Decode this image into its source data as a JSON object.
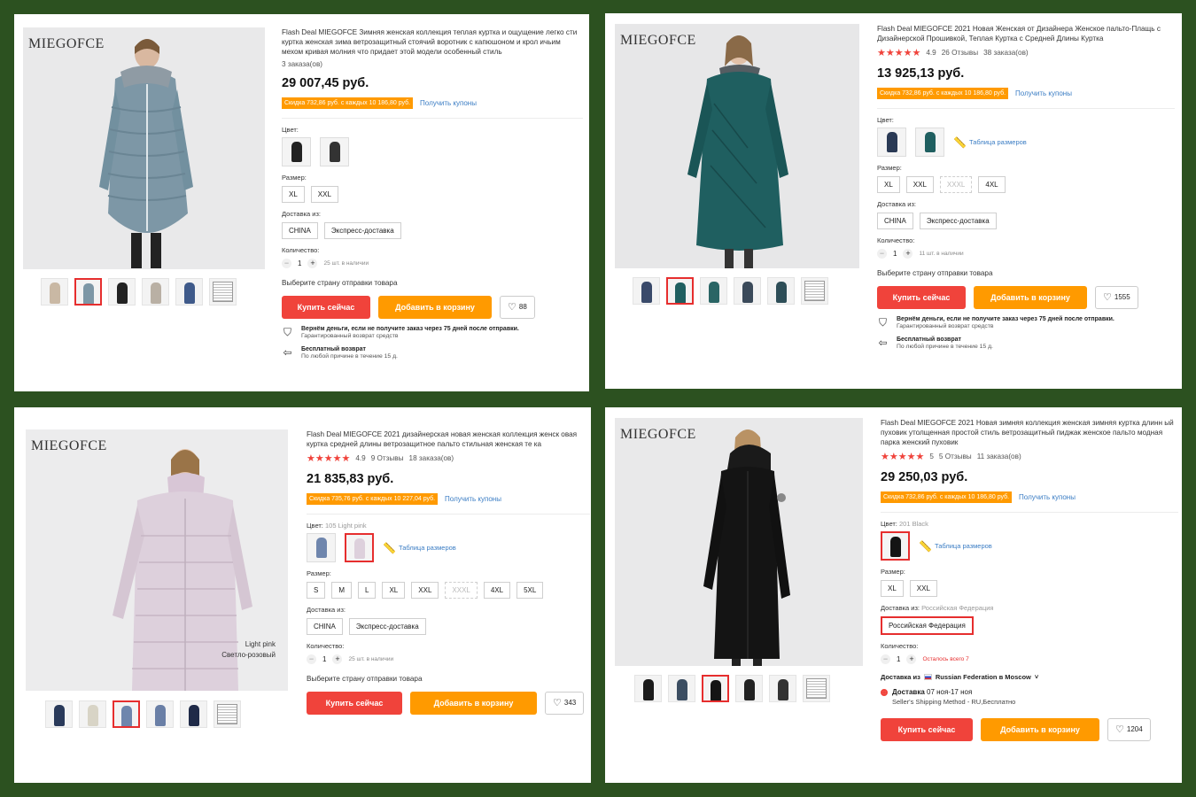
{
  "brand": "MIEGOFCE",
  "products": [
    {
      "title": "Flash Deal MIEGOFCE Зимняя женская коллекция теплая куртка и ощущение легко сти куртка женская зима ветрозащитный стоячий воротник с капюшоном и крол ичьим мехом кривая молния что придает этой модели особенный стиль",
      "orders": "3 заказа(ов)",
      "price": "29 007,45 руб.",
      "discount": "Скидка 732,86 руб. с каждых 10 186,80 руб.",
      "coupon_link": "Получить купоны",
      "color_label": "Цвет:",
      "size_label": "Размер:",
      "sizes": [
        "XL",
        "XXL"
      ],
      "ship_from_label": "Доставка из:",
      "ship_from": [
        "CHINA",
        "Экспресс-доставка"
      ],
      "qty_label": "Количество:",
      "qty_minus": "−",
      "qty_value": "1",
      "qty_plus": "+",
      "qty_avail": "25 шт. в наличии",
      "ship_note": "Выберите страну отправки товара",
      "buy": "Купить сейчас",
      "cart": "Добавить в корзину",
      "wish_count": "88",
      "guarantee_title": "Вернём деньги, если не получите заказ через 75 дней после отправки.",
      "guarantee_sub": "Гарантированный возврат средств",
      "return_title": "Бесплатный возврат",
      "return_sub": "По любой причине в течение 15 д."
    },
    {
      "title": "Flash Deal MIEGOFCE 2021 Новая Женская от Дизайнера Женское пальто-Плащь с Дизайнерской Прошивкой, Теплая Куртка с Средней Длины Куртка",
      "rating": "4.9",
      "reviews": "26 Отзывы",
      "orders": "38 заказа(ов)",
      "price": "13 925,13 руб.",
      "discount": "Скидка 732,86 руб. с каждых 10 186,80 руб.",
      "coupon_link": "Получить купоны",
      "color_label": "Цвет:",
      "size_table": "Таблица размеров",
      "size_label": "Размер:",
      "sizes": [
        "XL",
        "XXL",
        "XXXL",
        "4XL"
      ],
      "ship_from_label": "Доставка из:",
      "ship_from": [
        "CHINA",
        "Экспресс-доставка"
      ],
      "qty_label": "Количество:",
      "qty_minus": "−",
      "qty_value": "1",
      "qty_plus": "+",
      "qty_avail": "11 шт. в наличии",
      "ship_note": "Выберите страну отправки товара",
      "buy": "Купить сейчас",
      "cart": "Добавить в корзину",
      "wish_count": "1555",
      "guarantee_title": "Вернём деньги, если не получите заказ через 75 дней после отправки.",
      "guarantee_sub": "Гарантированный возврат средств",
      "return_title": "Бесплатный возврат",
      "return_sub": "По любой причине в течение 15 д."
    },
    {
      "title": "Flash Deal MIEGOFCE 2021 дизайнерская новая женская коллекция женск овая куртка средней длины ветрозащитное пальто стильная женская те ка",
      "rating": "4.9",
      "reviews": "9 Отзывы",
      "orders": "18 заказа(ов)",
      "price": "21 835,83 руб.",
      "discount": "Скидка 735,76 руб. с каждых 10 227,04 руб.",
      "coupon_link": "Получить купоны",
      "color_label": "Цвет:",
      "color_selected": "105 Light pink",
      "size_table": "Таблица размеров",
      "size_label": "Размер:",
      "sizes": [
        "S",
        "M",
        "L",
        "XL",
        "XXL",
        "XXXL",
        "4XL",
        "5XL"
      ],
      "ship_from_label": "Доставка из:",
      "ship_from": [
        "CHINA",
        "Экспресс-доставка"
      ],
      "qty_label": "Количество:",
      "qty_minus": "−",
      "qty_value": "1",
      "qty_plus": "+",
      "qty_avail": "25 шт. в наличии",
      "ship_note": "Выберите страну отправки товара",
      "buy": "Купить сейчас",
      "cart": "Добавить в корзину",
      "wish_count": "343",
      "photo_caption_1": "Light pink",
      "photo_caption_2": "Светло-розовый"
    },
    {
      "title": "Flash Deal MIEGOFCE 2021 Новая зимняя коллекция женская зимняя куртка длинн ый пуховик утолщенная простой стиль ветрозащитный пиджак женское пальто модная парка женский пуховик",
      "rating": "5",
      "reviews": "5 Отзывы",
      "orders": "11 заказа(ов)",
      "price": "29 250,03 руб.",
      "discount": "Скидка 732,86 руб. с каждых 10 186,80 руб.",
      "coupon_link": "Получить купоны",
      "color_label": "Цвет:",
      "color_selected": "201 Black",
      "size_table": "Таблица размеров",
      "size_label": "Размер:",
      "sizes": [
        "XL",
        "XXL"
      ],
      "ship_from_label": "Доставка из:",
      "ship_from_selected": "Российская Федерация",
      "ship_from": [
        "Российская Федерация"
      ],
      "qty_label": "Количество:",
      "qty_minus": "−",
      "qty_value": "1",
      "qty_plus": "+",
      "qty_avail": "Осталось всего 7",
      "delivery_to_label": "Доставка из",
      "delivery_to": "Russian Federation в Moscow",
      "delivery_label": "Доставка",
      "delivery_dates": "07 ноя-17 ноя",
      "delivery_method": "Seller's Shipping Method - RU,Бесплатно",
      "buy": "Купить сейчас",
      "cart": "Добавить в корзину",
      "wish_count": "1204"
    }
  ],
  "colors": {
    "background": "#2c5120",
    "buy_button": "#f0433b",
    "cart_button": "#ff9a00",
    "discount_badge": "#ff9a00",
    "link": "#3b7dc4",
    "active_border": "#e62e2e"
  },
  "icons": [
    "heart-icon",
    "shield-check-icon",
    "return-icon",
    "ruler-icon",
    "star-icon",
    "chevron-down-icon",
    "location-dot-icon"
  ]
}
